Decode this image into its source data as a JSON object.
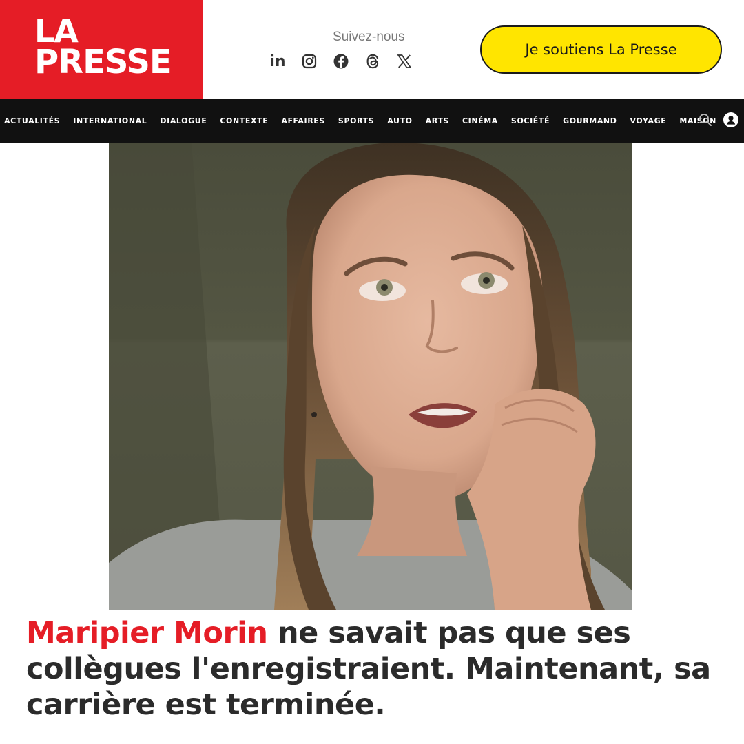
{
  "header": {
    "logo_line1": "LA",
    "logo_line2": "PRESSE",
    "follow_label": "Suivez-nous",
    "socials": [
      {
        "icon": "linkedin-icon",
        "label": "in"
      },
      {
        "icon": "instagram-icon"
      },
      {
        "icon": "facebook-icon"
      },
      {
        "icon": "threads-icon"
      },
      {
        "icon": "x-icon"
      }
    ],
    "support_label": "Je soutiens La Presse"
  },
  "nav": {
    "items": [
      "ACTUALITÉS",
      "INTERNATIONAL",
      "DIALOGUE",
      "CONTEXTE",
      "AFFAIRES",
      "SPORTS",
      "AUTO",
      "ARTS",
      "CINÉMA",
      "SOCIÉTÉ",
      "GOURMAND",
      "VOYAGE",
      "MAISON"
    ],
    "search_icon": "search-icon",
    "user_icon": "user-icon"
  },
  "article": {
    "headline_highlight": "Maripier Morin",
    "headline_rest": " ne savait pas que ses collègues l'enregistraient. Maintenant, sa carrière est terminée."
  },
  "colors": {
    "brand_red": "#e51d26",
    "support_yellow": "#ffe500",
    "nav_bg": "#111111",
    "headline_text": "#2b2b2b"
  }
}
